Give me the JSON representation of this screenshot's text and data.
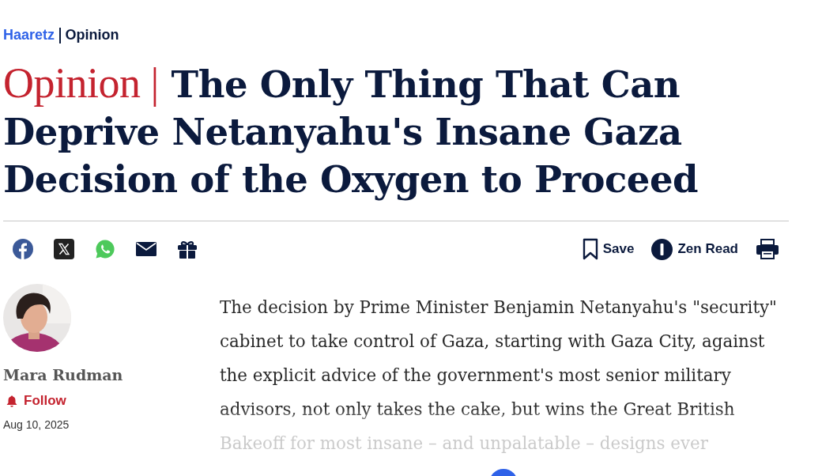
{
  "breadcrumb": {
    "brand": "Haaretz",
    "section": "Opinion"
  },
  "headline": {
    "kicker": "Opinion |",
    "title": "The Only Thing That Can Deprive Netanyahu's Insane Gaza Decision of the Oxygen to Proceed"
  },
  "share_icons": [
    {
      "kind": "facebook"
    },
    {
      "kind": "x"
    },
    {
      "kind": "whatsapp"
    },
    {
      "kind": "email"
    },
    {
      "kind": "gift"
    }
  ],
  "actions": [
    {
      "kind": "save",
      "label": "Save"
    },
    {
      "kind": "zen",
      "label": "Zen Read"
    },
    {
      "kind": "print"
    }
  ],
  "author": {
    "name": "Mara Rudman",
    "follow": "Follow",
    "date": "Aug 10, 2025"
  },
  "article": {
    "paragraph": "The decision by Prime Minister Benjamin Netanyahu's \"security\" cabinet to take control of Gaza, starting with Gaza City, against the explicit advice of the government's most senior military advisors, not only takes the cake, but wins the Great British Bakeoff for most insane – and unpalatable – designs ever"
  }
}
